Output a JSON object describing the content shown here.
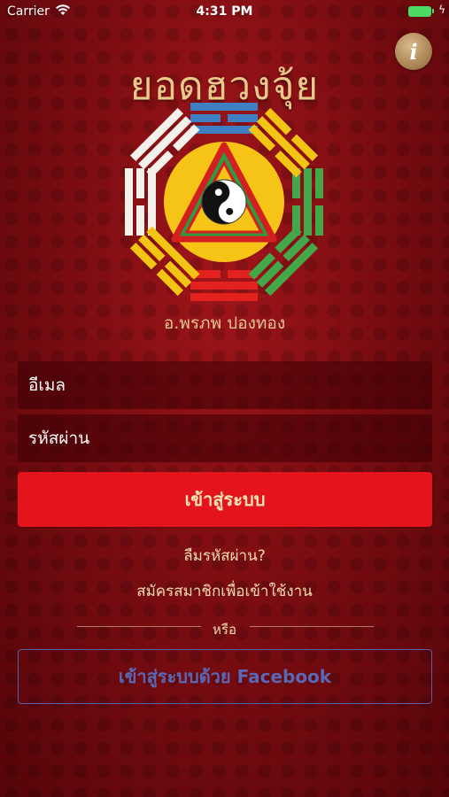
{
  "status_bar": {
    "carrier": "Carrier",
    "time": "4:31 PM",
    "wifi_icon": "wifi-icon",
    "battery_icon": "battery-icon"
  },
  "header": {
    "info_label": "i",
    "app_title": "ยอดฮวงจุ้ย",
    "subtitle": "อ.พรภพ ปองทอง",
    "logo_icon": "bagua-yin-yang-logo"
  },
  "form": {
    "email_placeholder": "อีเมล",
    "password_placeholder": "รหัสผ่าน",
    "login_label": "เข้าสู่ระบบ",
    "forgot_password": "ลืมรหัสผ่าน?",
    "register": "สมัครสมาชิกเพื่อเข้าใช้งาน",
    "or_label": "หรือ",
    "facebook_label": "เข้าสู่ระบบด้วย Facebook"
  },
  "colors": {
    "background": "#7c0d12",
    "login_button": "#e4141c",
    "gold_text": "#e9c98a",
    "facebook_blue": "#5a67b5"
  }
}
